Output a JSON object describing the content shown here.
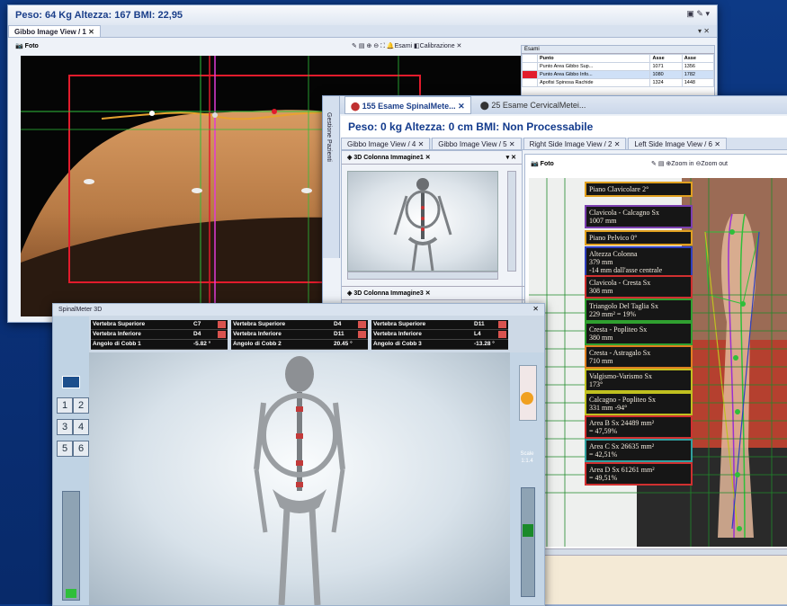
{
  "window1": {
    "title": "Peso: 64 Kg Altezza: 167 BMI: 22,95",
    "tab": "Gibbo Image View / 1",
    "photo_tab": "Foto",
    "toolbar": {
      "exams": "Esami",
      "calibration": "Calibrazione"
    },
    "grid": {
      "title": "Esami",
      "columns": [
        "Punto",
        "Asse",
        "Asse"
      ],
      "rows": [
        [
          "Punto Area Gibbo Sup...",
          "1071",
          "1356"
        ],
        [
          "Punto Area Gibbo Info...",
          "1080",
          "1782"
        ],
        [
          "Apofisi Spinosa Rachide",
          "1324",
          "1448"
        ]
      ]
    }
  },
  "window2": {
    "title_tab": "155 Esame SpinalMete...",
    "title_tab2": "25 Esame CervicalMetei...",
    "header": "Peso: 0 kg Altezza: 0 cm BMI: Non Processabile",
    "side_label": "Gestione Pazienti",
    "tabs": [
      "Gibbo Image View / 4",
      "Gibbo Image View / 5",
      "Right Side Image View / 2",
      "Left Side Image View / 6"
    ],
    "panel1_title": "3D Colonna Immagine1",
    "panel2_title": "3D Colonna Immagine3",
    "main_tab": "Foto",
    "toolbar": {
      "zoom_in": "Zoom in",
      "zoom_out": "Zoom out"
    },
    "measures": [
      {
        "text": "Piano Clavicolare 2°",
        "color": "#e0a020"
      },
      {
        "text": "Clavicola - Calcagno Sx\n1007 mm",
        "color": "#7b3fb0"
      },
      {
        "text": "Piano Pelvico 0°",
        "color": "#e0a020"
      },
      {
        "text": "Altezza Colonna\n379 mm\n-14 mm dall'asse centrale",
        "color": "#3040c0"
      },
      {
        "text": "Clavicola - Cresta Sx\n308 mm",
        "color": "#d03030"
      },
      {
        "text": "Triangolo Del Taglia Sx\n229 mm² = 19%",
        "color": "#30a030"
      },
      {
        "text": "Cresta - Popliteo Sx\n380 mm",
        "color": "#30a030"
      },
      {
        "text": "Cresta - Astragalo Sx\n710 mm",
        "color": "#e08020"
      },
      {
        "text": "Valgismo-Varismo Sx\n173°",
        "color": "#c0c020"
      },
      {
        "text": "Calcagno - Popliteo Sx\n331 mm -94°",
        "color": "#c0c020"
      },
      {
        "text": "Area B Sx 24489 mm²\n= 47,59%",
        "color": "#d03030"
      },
      {
        "text": "Area C Sx 26635 mm²\n= 42,51%",
        "color": "#30a0a0"
      },
      {
        "text": "Area D Sx 61261 mm²\n= 49,51%",
        "color": "#d03030"
      }
    ]
  },
  "window3": {
    "title": "SpinalMeter 3D",
    "cobb": [
      {
        "rows": [
          [
            "Vertebra Superiore",
            "C7"
          ],
          [
            "Vertebra Inferiore",
            "D4"
          ],
          [
            "Angolo di Cobb 1",
            "-5.82 °"
          ]
        ]
      },
      {
        "rows": [
          [
            "Vertebra Superiore",
            "D4"
          ],
          [
            "Vertebra Inferiore",
            "D11"
          ],
          [
            "Angolo di Cobb 2",
            "20.45 °"
          ]
        ]
      },
      {
        "rows": [
          [
            "Vertebra Superiore",
            "D11"
          ],
          [
            "Vertebra Inferiore",
            "L4"
          ],
          [
            "Angolo di Cobb 3",
            "-13.28 °"
          ]
        ]
      }
    ],
    "nav_numbers": [
      "1",
      "2",
      "3",
      "4",
      "5",
      "6"
    ],
    "scale_label": "Scale",
    "scale_value": "1:1.4"
  }
}
